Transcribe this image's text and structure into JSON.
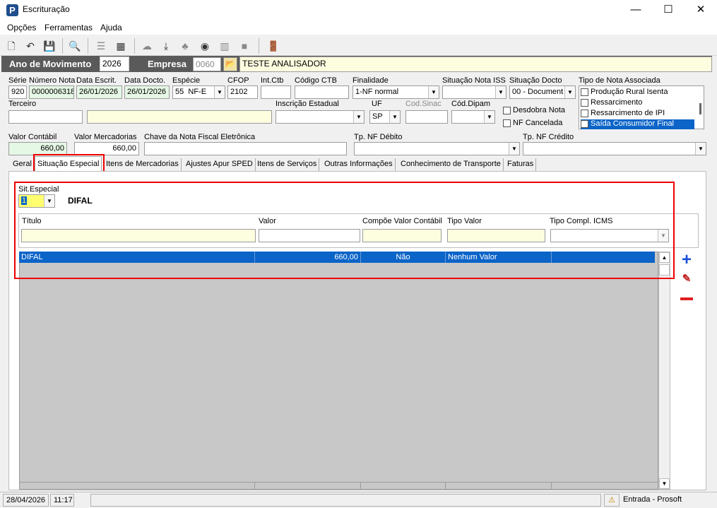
{
  "window": {
    "title": "Escrituração",
    "app_icon": "P",
    "minimize": "—",
    "maximize": "☐",
    "close": "✕"
  },
  "menu": [
    "Opções",
    "Ferramentas",
    "Ajuda"
  ],
  "header": {
    "ano_label": "Ano de Movimento",
    "ano_value": "2026",
    "empresa_label": "Empresa",
    "empresa_code": "0060",
    "empresa_name": "TESTE ANALISADOR"
  },
  "labels": {
    "serie": "Série",
    "numero_nota": "Número Nota",
    "data_escrit": "Data Escrit.",
    "data_docto": "Data Docto.",
    "especie": "Espécie",
    "cfop": "CFOP",
    "int_ctb": "Int.Ctb",
    "codigo_ctb": "Código CTB",
    "finalidade": "Finalidade",
    "situacao_iss": "Situação Nota ISS",
    "situacao_docto": "Situação Docto",
    "tipo_nota": "Tipo de Nota Associada",
    "terceiro": "Terceiro",
    "insc_estadual": "Inscrição Estadual",
    "uf": "UF",
    "cod_sinac": "Cod.Sinac",
    "cod_dipam": "Cód.Dipam",
    "desdobra": "Desdobra Nota",
    "cancelada": "NF Cancelada",
    "valor_contabil": "Valor Contábil",
    "valor_mercadorias": "Valor Mercadorias",
    "chave_nfe": "Chave da Nota Fiscal Eletrônica",
    "tp_debito": "Tp. NF Débito",
    "tp_credito": "Tp. NF Crédito"
  },
  "values": {
    "serie": "920",
    "numero_nota": "0000006318",
    "data_escrit": "26/01/2026",
    "data_docto": "26/01/2026",
    "especie_code": "55",
    "especie_name": "NF-E",
    "cfop": "2102",
    "finalidade": "1-NF normal",
    "situacao_docto": "00 - Document",
    "uf": "SP",
    "valor_contabil": "660,00",
    "valor_mercadorias": "660,00"
  },
  "tipo_nota_items": [
    {
      "label": "Produção Rural Isenta",
      "checked": false
    },
    {
      "label": "Ressarcimento",
      "checked": false
    },
    {
      "label": "Ressarcimento de IPI",
      "checked": false
    },
    {
      "label": "Saída Consumidor Final",
      "checked": true
    }
  ],
  "tabs": [
    "Geral",
    "Situação Especial",
    "Itens de Mercadorias",
    "Ajustes Apur SPED",
    "Itens de Serviços",
    "Outras Informações",
    "Conhecimento de Transporte",
    "Faturas"
  ],
  "sit_especial": {
    "label": "Sit.Especial",
    "value": "1",
    "desc": "DIFAL",
    "columns": [
      "Título",
      "Valor",
      "Compõe Valor Contábil",
      "Tipo Valor",
      "Tipo Compl. ICMS"
    ],
    "rows": [
      {
        "titulo": "DIFAL",
        "valor": "660,00",
        "compoe": "Não",
        "tipo_valor": "Nenhum Valor",
        "tipo_compl": ""
      }
    ]
  },
  "status": {
    "date": "28/04/2026",
    "time": "11:17",
    "warning": "⚠",
    "module": "Entrada - Prosoft"
  },
  "colors": {
    "accent": "#0b64c8",
    "highlight_border": "#e00000",
    "add": "#1a4fd6",
    "remove": "#e02020"
  }
}
